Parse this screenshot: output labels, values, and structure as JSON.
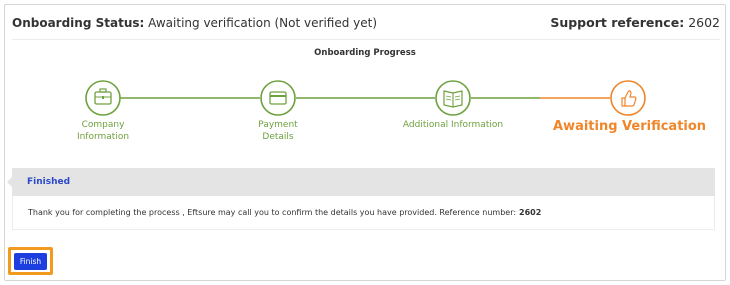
{
  "header": {
    "status_label": "Onboarding Status:",
    "status_value": "Awaiting verification (Not verified yet)",
    "reference_label": "Support reference:",
    "reference_value": "2602"
  },
  "progress": {
    "title": "Onboarding Progress",
    "steps": [
      {
        "line1": "Company",
        "line2": "Information",
        "icon": "briefcase-icon",
        "state": "completed"
      },
      {
        "line1": "Payment",
        "line2": "Details",
        "icon": "credit-card-icon",
        "state": "completed"
      },
      {
        "line1": "Additional Information",
        "line2": "",
        "icon": "book-icon",
        "state": "completed"
      },
      {
        "line1": "Awaiting Verification",
        "line2": "",
        "icon": "thumbs-up-icon",
        "state": "active"
      }
    ]
  },
  "colors": {
    "completed": "#6fa13f",
    "active": "#f0862a",
    "finished_text": "#2b49c9",
    "finish_button": "#1d3fe0",
    "finish_outline": "#f29a1f"
  },
  "completion": {
    "title": "Finished",
    "message": "Thank you for completing the process , Eftsure may call you to confirm the details you have provided. Reference number:",
    "reference_number": "2602"
  },
  "actions": {
    "finish_label": "Finish"
  }
}
